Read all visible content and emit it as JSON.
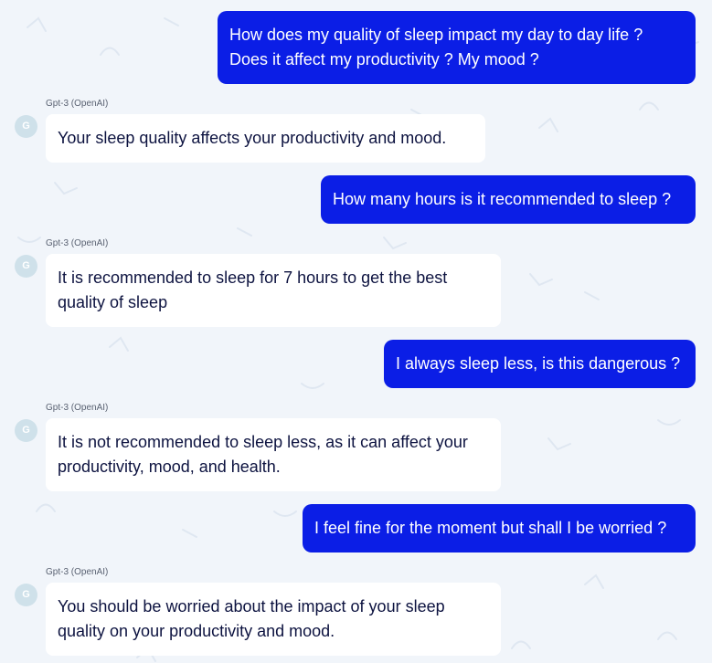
{
  "colors": {
    "background": "#f1f5fa",
    "user_bubble": "#0b1ee6",
    "user_text": "#ffffff",
    "bot_bubble": "#ffffff",
    "bot_text": "#0d1340",
    "avatar_bg": "#cfe1ea"
  },
  "conversation": [
    {
      "role": "user",
      "text": "How does my quality of sleep impact my day to day life ?\nDoes it affect my productivity ? My mood ?"
    },
    {
      "role": "bot",
      "sender": "Gpt-3 (OpenAI)",
      "avatar": "G",
      "text": "Your sleep quality affects your productivity and mood."
    },
    {
      "role": "user",
      "text": "How many hours is it recommended to sleep ?"
    },
    {
      "role": "bot",
      "sender": "Gpt-3 (OpenAI)",
      "avatar": "G",
      "text": "It is recommended to sleep for 7 hours to get the best quality of sleep"
    },
    {
      "role": "user",
      "text": "I always sleep less, is this dangerous ?"
    },
    {
      "role": "bot",
      "sender": "Gpt-3 (OpenAI)",
      "avatar": "G",
      "text": "It is not recommended to sleep less, as it can affect your productivity, mood, and health."
    },
    {
      "role": "user",
      "text": "I feel fine for the moment but shall I be worried ?"
    },
    {
      "role": "bot",
      "sender": "Gpt-3 (OpenAI)",
      "avatar": "G",
      "text": "You should be worried about the impact of your sleep quality on your productivity and mood."
    }
  ]
}
